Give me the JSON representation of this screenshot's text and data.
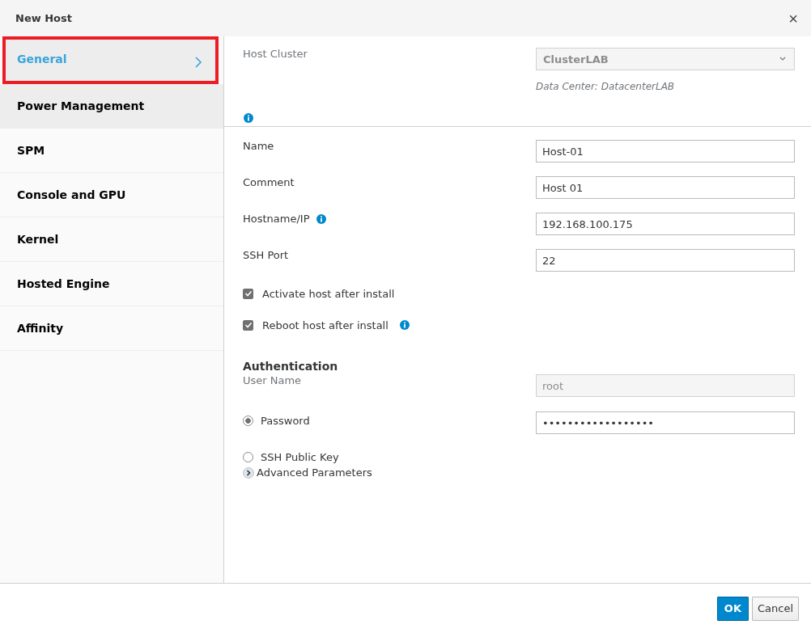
{
  "window": {
    "title": "New Host",
    "close": "×"
  },
  "tabs": [
    {
      "label": "General",
      "selected": true,
      "hovered": false,
      "marked": true
    },
    {
      "label": "Power Management",
      "selected": false,
      "hovered": true,
      "marked": false
    },
    {
      "label": "SPM",
      "selected": false,
      "hovered": false,
      "marked": false
    },
    {
      "label": "Console and GPU",
      "selected": false,
      "hovered": false,
      "marked": false
    },
    {
      "label": "Kernel",
      "selected": false,
      "hovered": false,
      "marked": false
    },
    {
      "label": "Hosted Engine",
      "selected": false,
      "hovered": false,
      "marked": false
    },
    {
      "label": "Affinity",
      "selected": false,
      "hovered": false,
      "marked": false
    }
  ],
  "host_cluster": {
    "label": "Host Cluster",
    "value": "ClusterLAB",
    "note": "Data Center: DatacenterLAB"
  },
  "fields": [
    {
      "label": "Name",
      "value": "Host-01",
      "info": false
    },
    {
      "label": "Comment",
      "value": "Host 01",
      "info": false
    },
    {
      "label": "Hostname/IP",
      "value": "192.168.100.175",
      "info": true
    },
    {
      "label": "SSH Port",
      "value": "22",
      "info": false
    }
  ],
  "checkboxes": [
    {
      "label": "Activate host after install",
      "checked": true,
      "info": false
    },
    {
      "label": "Reboot host after install",
      "checked": true,
      "info": true
    }
  ],
  "authentication": {
    "heading": "Authentication",
    "user_label": "User Name",
    "user_value": "root",
    "user_disabled": true,
    "options": [
      {
        "label": "Password",
        "selected": true,
        "value": "••••••••••••••••••"
      },
      {
        "label": "SSH Public Key",
        "selected": false
      }
    ]
  },
  "advanced": {
    "label": "Advanced Parameters",
    "expanded": false
  },
  "buttons": [
    {
      "label": "OK",
      "primary": true
    },
    {
      "label": "Cancel",
      "primary": false
    }
  ]
}
